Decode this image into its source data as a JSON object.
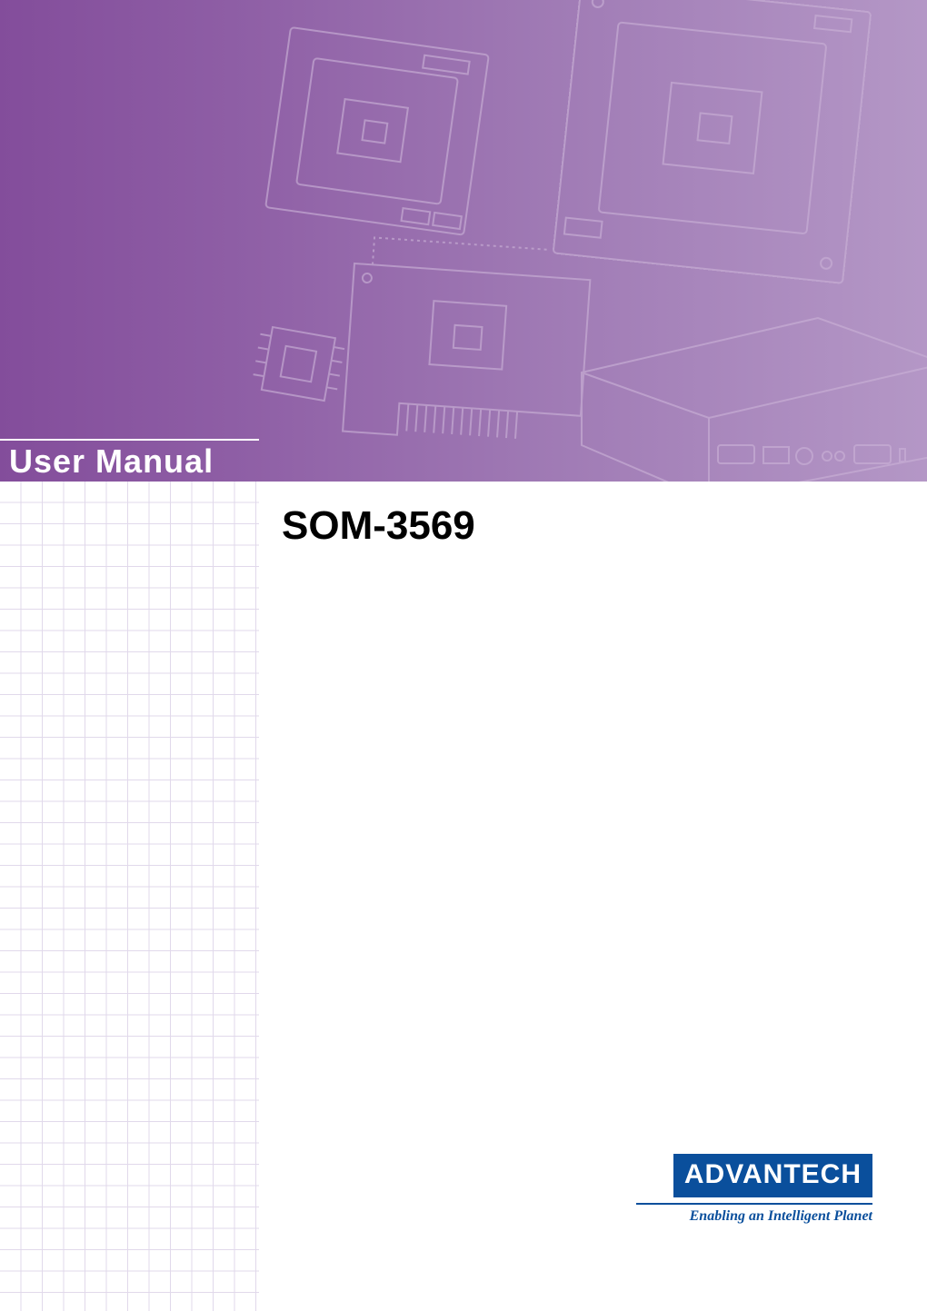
{
  "cover": {
    "section_label": "User Manual",
    "product_title": "SOM-3569"
  },
  "brand": {
    "name": "ADVANTECH",
    "tagline": "Enabling an Intelligent Planet"
  },
  "colors": {
    "purple_dark": "#834d9b",
    "purple_light": "#b497c6",
    "brand_blue": "#0a4f9c",
    "grid_line": "#e1d9eb"
  }
}
